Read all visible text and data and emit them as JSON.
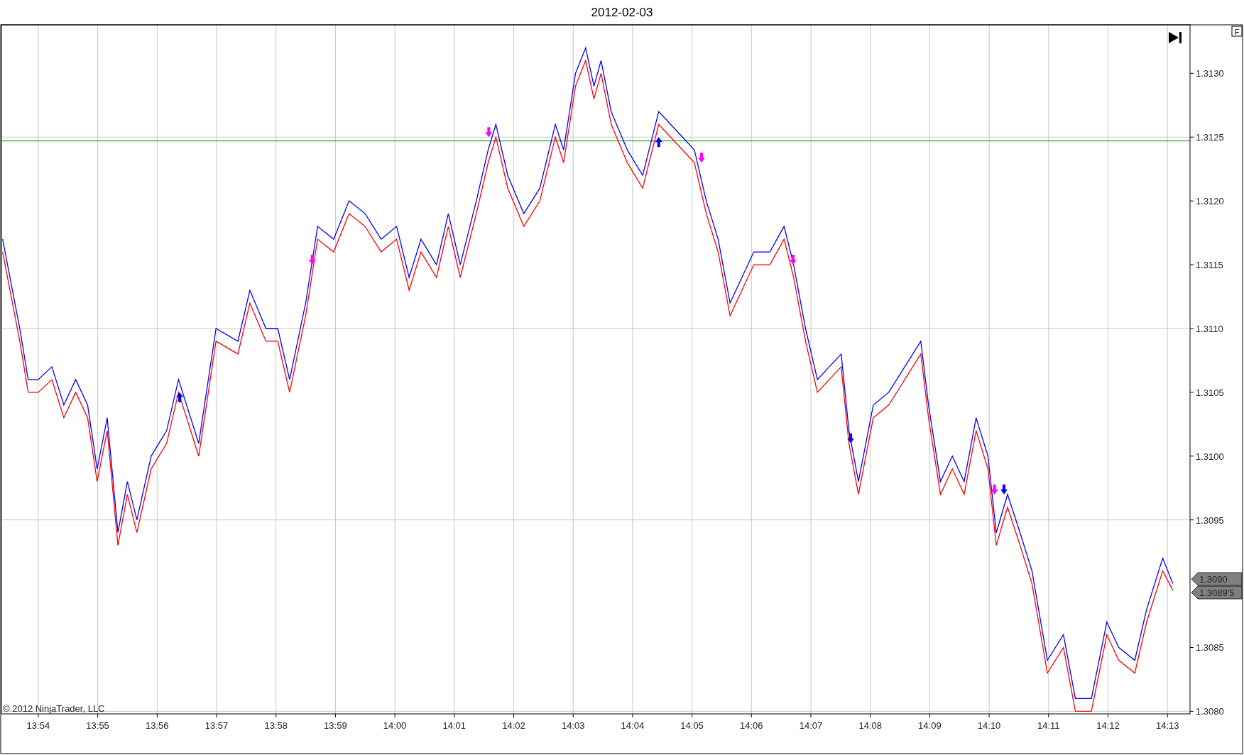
{
  "chart": {
    "corner_button": "F",
    "copyright": "© 2012 NinjaTrader, LLC",
    "price_tags": [
      {
        "text": "1.3090"
      },
      {
        "text": "1.3089'5"
      }
    ],
    "chart_data": {
      "type": "line",
      "title": "2012-02-03",
      "grid": true,
      "xlim": [
        833.38,
        853.38
      ],
      "ylim": [
        1.30798,
        1.31338
      ],
      "xticks": [
        {
          "value": 834,
          "label": "13:54"
        },
        {
          "value": 835,
          "label": "13:55"
        },
        {
          "value": 836,
          "label": "13:56"
        },
        {
          "value": 837,
          "label": "13:57"
        },
        {
          "value": 838,
          "label": "13:58"
        },
        {
          "value": 839,
          "label": "13:59"
        },
        {
          "value": 840,
          "label": "14:00"
        },
        {
          "value": 841,
          "label": "14:01"
        },
        {
          "value": 842,
          "label": "14:02"
        },
        {
          "value": 843,
          "label": "14:03"
        },
        {
          "value": 844,
          "label": "14:04"
        },
        {
          "value": 845,
          "label": "14:05"
        },
        {
          "value": 846,
          "label": "14:06"
        },
        {
          "value": 847,
          "label": "14:07"
        },
        {
          "value": 848,
          "label": "14:08"
        },
        {
          "value": 849,
          "label": "14:09"
        },
        {
          "value": 850,
          "label": "14:10"
        },
        {
          "value": 851,
          "label": "14:11"
        },
        {
          "value": 852,
          "label": "14:12"
        },
        {
          "value": 853,
          "label": "14:13"
        }
      ],
      "yticks": [
        {
          "value": 1.308,
          "label": "1.3080"
        },
        {
          "value": 1.3085,
          "label": "1.3085"
        },
        {
          "value": 1.3095,
          "label": "1.3095"
        },
        {
          "value": 1.31,
          "label": "1.3100"
        },
        {
          "value": 1.3105,
          "label": "1.3105"
        },
        {
          "value": 1.311,
          "label": "1.3110"
        },
        {
          "value": 1.3115,
          "label": "1.3115"
        },
        {
          "value": 1.312,
          "label": "1.3120"
        },
        {
          "value": 1.3125,
          "label": "1.3125"
        },
        {
          "value": 1.313,
          "label": "1.3130"
        }
      ],
      "x": [
        833.4,
        833.69,
        833.83,
        834,
        834.23,
        834.43,
        834.63,
        834.83,
        834.99,
        835.16,
        835.34,
        835.5,
        835.66,
        835.9,
        836.16,
        836.36,
        836.7,
        836.99,
        837.36,
        837.56,
        837.83,
        838.03,
        838.23,
        838.5,
        838.7,
        838.97,
        839.23,
        839.5,
        839.77,
        840.03,
        840.24,
        840.44,
        840.7,
        840.9,
        841.1,
        841.37,
        841.57,
        841.7,
        841.9,
        842.17,
        842.44,
        842.7,
        842.84,
        843.04,
        843.21,
        843.35,
        843.47,
        843.64,
        843.91,
        844.17,
        844.44,
        844.64,
        844.84,
        845.04,
        845.24,
        845.44,
        845.64,
        845.84,
        846.04,
        846.31,
        846.55,
        846.71,
        846.91,
        847.11,
        847.31,
        847.51,
        847.64,
        847.8,
        848.05,
        848.31,
        848.58,
        848.85,
        848.98,
        849.18,
        849.38,
        849.58,
        849.78,
        849.98,
        850.12,
        850.31,
        850.52,
        850.72,
        850.98,
        851.25,
        851.45,
        851.72,
        851.98,
        852.18,
        852.45,
        852.65,
        852.92,
        853.09
      ],
      "series": [
        {
          "color": "#0000ff",
          "values": [
            1.3117,
            1.311,
            1.3106,
            1.3106,
            1.3107,
            1.3104,
            1.3106,
            1.3104,
            1.3099,
            1.3103,
            1.3094,
            1.3098,
            1.3095,
            1.31,
            1.3102,
            1.3106,
            1.3101,
            1.311,
            1.3109,
            1.3113,
            1.311,
            1.311,
            1.3106,
            1.3112,
            1.3118,
            1.3117,
            1.312,
            1.3119,
            1.3117,
            1.3118,
            1.3114,
            1.3117,
            1.3115,
            1.3119,
            1.3115,
            1.312,
            1.3124,
            1.3126,
            1.3122,
            1.3119,
            1.3121,
            1.3126,
            1.3124,
            1.313,
            1.3132,
            1.3129,
            1.3131,
            1.3127,
            1.3124,
            1.3122,
            1.3127,
            1.3126,
            1.3125,
            1.3124,
            1.312,
            1.3117,
            1.3112,
            1.3114,
            1.3116,
            1.3116,
            1.3118,
            1.3115,
            1.311,
            1.3106,
            1.3107,
            1.3108,
            1.3102,
            1.3098,
            1.3104,
            1.3105,
            1.3107,
            1.3109,
            1.3104,
            1.3098,
            1.31,
            1.3098,
            1.3103,
            1.31,
            1.3094,
            1.3097,
            1.3094,
            1.3091,
            1.3084,
            1.3086,
            1.3081,
            1.3081,
            1.3087,
            1.3085,
            1.3084,
            1.3088,
            1.3092,
            1.309
          ]
        },
        {
          "color": "#ff0000",
          "values": [
            1.3116,
            1.3109,
            1.3105,
            1.3105,
            1.3106,
            1.3103,
            1.3105,
            1.3103,
            1.3098,
            1.3102,
            1.3093,
            1.3097,
            1.3094,
            1.3099,
            1.3101,
            1.3105,
            1.31,
            1.3109,
            1.3108,
            1.3112,
            1.3109,
            1.3109,
            1.3105,
            1.3111,
            1.3117,
            1.3116,
            1.3119,
            1.3118,
            1.3116,
            1.3117,
            1.3113,
            1.3116,
            1.3114,
            1.3118,
            1.3114,
            1.3119,
            1.3123,
            1.3125,
            1.3121,
            1.3118,
            1.312,
            1.3125,
            1.3123,
            1.3129,
            1.3131,
            1.3128,
            1.313,
            1.3126,
            1.3123,
            1.3121,
            1.3126,
            1.3125,
            1.3124,
            1.3123,
            1.3119,
            1.3116,
            1.3111,
            1.3113,
            1.3115,
            1.3115,
            1.3117,
            1.3114,
            1.3109,
            1.3105,
            1.3106,
            1.3107,
            1.3101,
            1.3097,
            1.3103,
            1.3104,
            1.3106,
            1.3108,
            1.3103,
            1.3097,
            1.3099,
            1.3097,
            1.3102,
            1.3099,
            1.3093,
            1.3096,
            1.3093,
            1.309,
            1.3083,
            1.3085,
            1.308,
            1.308,
            1.3086,
            1.3084,
            1.3083,
            1.3087,
            1.3091,
            1.30895
          ]
        }
      ],
      "ref_lines": [
        {
          "axis": "y",
          "value": 1.31247,
          "color": "#008000"
        }
      ]
    },
    "trade_markers": [
      {
        "kind": "down",
        "color": "#ff00ff"
      },
      {
        "kind": "down",
        "color": "#ff00ff"
      },
      {
        "kind": "down",
        "color": "#ff00ff"
      },
      {
        "kind": "down",
        "color": "#ff00ff"
      },
      {
        "kind": "down",
        "color": "#ff00ff"
      },
      {
        "kind": "up",
        "color": "#0000ff"
      },
      {
        "kind": "up",
        "color": "#0000ff"
      },
      {
        "kind": "down",
        "color": "#0000ff"
      },
      {
        "kind": "down",
        "color": "#0000ff"
      }
    ]
  }
}
